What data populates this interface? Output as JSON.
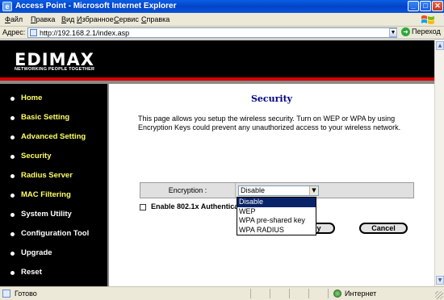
{
  "window": {
    "title": "Access Point - Microsoft Internet Explorer",
    "controls": {
      "minimize": "_",
      "maximize": "□",
      "close": "✕"
    }
  },
  "menu": [
    "Файл",
    "Правка",
    "Вид",
    "Избранное",
    "Сервис",
    "Справка"
  ],
  "address": {
    "label": "Адрес:",
    "url": "http://192.168.2.1/index.asp",
    "go_label": "Переход"
  },
  "brand": {
    "logo": "EDIMAX",
    "tagline": "NETWORKING PEOPLE TOGETHER",
    "accent_red": "#d40000"
  },
  "sidebar": {
    "items": [
      {
        "label": "Home"
      },
      {
        "label": "Basic Setting"
      },
      {
        "label": "Advanced Setting"
      },
      {
        "label": "Security"
      },
      {
        "label": "Radius Server"
      },
      {
        "label": "MAC Filtering"
      },
      {
        "label": "System Utility"
      },
      {
        "label": "Configuration Tool"
      },
      {
        "label": "Upgrade"
      },
      {
        "label": "Reset"
      }
    ]
  },
  "main": {
    "title": "Security",
    "description": "This page allows you setup the wireless security. Turn on WEP or WPA by using Encryption Keys could prevent any unauthorized access to your wireless network.",
    "encryption": {
      "label": "Encryption :",
      "selected": "Disable",
      "options": [
        "Disable",
        "WEP",
        "WPA pre-shared key",
        "WPA RADIUS"
      ]
    },
    "enable_8021x": {
      "label": "Enable 802.1x Authentica",
      "checked": false
    },
    "apply_label": "Apply",
    "cancel_label": "Cancel"
  },
  "status": {
    "text": "Готово",
    "zone": "Интернет"
  }
}
